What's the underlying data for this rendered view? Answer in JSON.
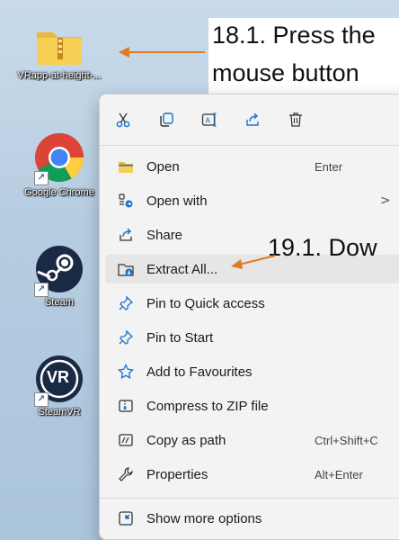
{
  "desktop": {
    "icons": [
      {
        "label": "VRapp-at-height-...",
        "icon": "zip-folder-icon"
      },
      {
        "label": "Google Chrome",
        "icon": "chrome-icon"
      },
      {
        "label": "Steam",
        "icon": "steam-icon"
      },
      {
        "label": "SteamVR",
        "icon": "steamvr-icon"
      }
    ],
    "vr_badge": "VR"
  },
  "annotations": {
    "step_18_line1": "18.1. Press the",
    "step_18_line2": "mouse button",
    "step_19": "19.1. Dow",
    "arrow_color": "#e07b22"
  },
  "context_menu": {
    "quick_actions": [
      {
        "icon": "cut-icon"
      },
      {
        "icon": "copy-icon"
      },
      {
        "icon": "rename-icon"
      },
      {
        "icon": "share-icon"
      },
      {
        "icon": "delete-icon"
      }
    ],
    "items": [
      {
        "label": "Open",
        "shortcut": "Enter",
        "icon": "folder-open-icon"
      },
      {
        "label": "Open with",
        "shortcut": "",
        "icon": "open-with-icon",
        "arrow": ">"
      },
      {
        "label": "Share",
        "shortcut": "",
        "icon": "share-icon"
      },
      {
        "label": "Extract All...",
        "shortcut": "",
        "icon": "extract-icon"
      },
      {
        "label": "Pin to Quick access",
        "shortcut": "",
        "icon": "pin-icon"
      },
      {
        "label": "Pin to Start",
        "shortcut": "",
        "icon": "pin-icon"
      },
      {
        "label": "Add to Favourites",
        "shortcut": "",
        "icon": "star-icon"
      },
      {
        "label": "Compress to ZIP file",
        "shortcut": "",
        "icon": "zip-icon"
      },
      {
        "label": "Copy as path",
        "shortcut": "Ctrl+Shift+C",
        "icon": "copy-path-icon"
      },
      {
        "label": "Properties",
        "shortcut": "Alt+Enter",
        "icon": "wrench-icon"
      },
      {
        "label": "Show more options",
        "shortcut": "",
        "icon": "more-options-icon"
      }
    ],
    "accent": "#1a73c9"
  }
}
